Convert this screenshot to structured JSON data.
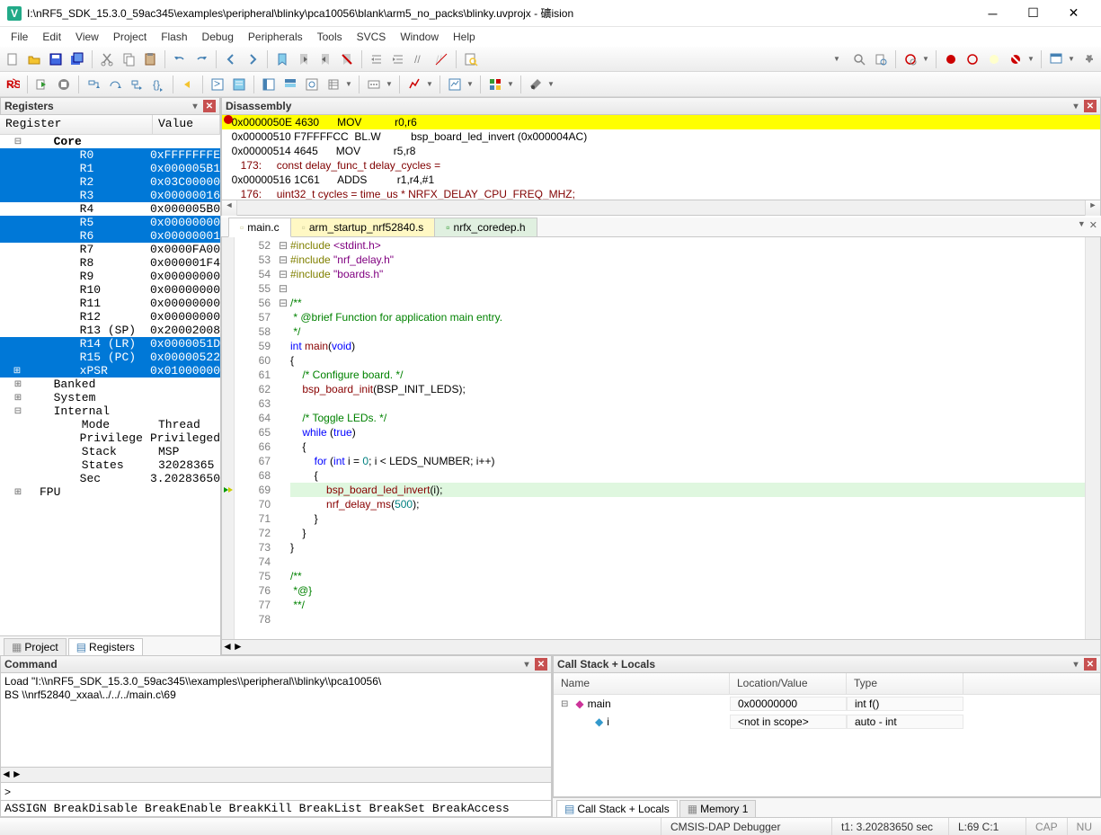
{
  "title": "I:\\nRF5_SDK_15.3.0_59ac345\\examples\\peripheral\\blinky\\pca10056\\blank\\arm5_no_packs\\blinky.uvprojx - 礦ision",
  "menus": [
    "File",
    "Edit",
    "View",
    "Project",
    "Flash",
    "Debug",
    "Peripherals",
    "Tools",
    "SVCS",
    "Window",
    "Help"
  ],
  "panels": {
    "registers_title": "Registers",
    "disassembly_title": "Disassembly",
    "command_title": "Command",
    "callstack_title": "Call Stack + Locals"
  },
  "reg_headers": [
    "Register",
    "Value"
  ],
  "registers": [
    {
      "n": "Core",
      "v": "",
      "tree": "⊟",
      "i": 0,
      "sel": false,
      "bold": true
    },
    {
      "n": "R0",
      "v": "0xFFFFFFFE",
      "i": 2,
      "sel": true
    },
    {
      "n": "R1",
      "v": "0x000005B1",
      "i": 2,
      "sel": true
    },
    {
      "n": "R2",
      "v": "0x03C00000",
      "i": 2,
      "sel": true
    },
    {
      "n": "R3",
      "v": "0x00000016",
      "i": 2,
      "sel": true
    },
    {
      "n": "R4",
      "v": "0x000005B0",
      "i": 2,
      "sel": false
    },
    {
      "n": "R5",
      "v": "0x00000000",
      "i": 2,
      "sel": true
    },
    {
      "n": "R6",
      "v": "0x00000001",
      "i": 2,
      "sel": true
    },
    {
      "n": "R7",
      "v": "0x0000FA00",
      "i": 2,
      "sel": false
    },
    {
      "n": "R8",
      "v": "0x000001F4",
      "i": 2,
      "sel": false
    },
    {
      "n": "R9",
      "v": "0x00000000",
      "i": 2,
      "sel": false
    },
    {
      "n": "R10",
      "v": "0x00000000",
      "i": 2,
      "sel": false
    },
    {
      "n": "R11",
      "v": "0x00000000",
      "i": 2,
      "sel": false
    },
    {
      "n": "R12",
      "v": "0x00000000",
      "i": 2,
      "sel": false
    },
    {
      "n": "R13 (SP)",
      "v": "0x20002008",
      "i": 2,
      "sel": false
    },
    {
      "n": "R14 (LR)",
      "v": "0x0000051D",
      "i": 2,
      "sel": true
    },
    {
      "n": "R15 (PC)",
      "v": "0x00000522",
      "i": 2,
      "sel": true
    },
    {
      "n": "xPSR",
      "v": "0x01000000",
      "tree": "⊞",
      "i": 2,
      "sel": true
    },
    {
      "n": "Banked",
      "v": "",
      "tree": "⊞",
      "i": 0,
      "sel": false
    },
    {
      "n": "System",
      "v": "",
      "tree": "⊞",
      "i": 0,
      "sel": false
    },
    {
      "n": "Internal",
      "v": "",
      "tree": "⊟",
      "i": 0,
      "sel": false
    },
    {
      "n": "Mode",
      "v": "Thread",
      "i": 2,
      "sel": false
    },
    {
      "n": "Privilege",
      "v": "Privileged",
      "i": 2,
      "sel": false
    },
    {
      "n": "Stack",
      "v": "MSP",
      "i": 2,
      "sel": false
    },
    {
      "n": "States",
      "v": "32028365",
      "i": 2,
      "sel": false
    },
    {
      "n": "Sec",
      "v": "3.20283650",
      "i": 2,
      "sel": false
    },
    {
      "n": "FPU",
      "v": "",
      "tree": "⊞",
      "i": -1,
      "sel": false
    }
  ],
  "reg_bottom_tabs": [
    "Project",
    "Registers"
  ],
  "disasm": [
    {
      "t": "0x0000050E 4630      MOV           r0,r6",
      "cur": true,
      "bp": true
    },
    {
      "t": "0x00000510 F7FFFFCC  BL.W          bsp_board_led_invert (0x000004AC)"
    },
    {
      "t": "0x00000514 4645      MOV           r5,r8"
    },
    {
      "t": "   173:     const delay_func_t delay_cycles =",
      "src": true
    },
    {
      "t": "0x00000516 1C61      ADDS          r1,r4,#1"
    },
    {
      "t": "   176:     uint32_t cycles = time_us * NRFX_DELAY_CPU_FREQ_MHZ;",
      "src": true
    }
  ],
  "editor_tabs": [
    {
      "label": "main.c",
      "kind": "active"
    },
    {
      "label": "arm_startup_nrf52840.s",
      "kind": "yellow"
    },
    {
      "label": "nrfx_coredep.h",
      "kind": "green"
    }
  ],
  "first_line": 52,
  "code": [
    {
      "seg": [
        [
          "pp",
          "#include "
        ],
        [
          "inc",
          "<stdint.h>"
        ]
      ]
    },
    {
      "seg": [
        [
          "pp",
          "#include "
        ],
        [
          "inc",
          "\"nrf_delay.h\""
        ]
      ]
    },
    {
      "seg": [
        [
          "pp",
          "#include "
        ],
        [
          "inc",
          "\"boards.h\""
        ]
      ]
    },
    {
      "seg": []
    },
    {
      "fold": "⊟",
      "seg": [
        [
          "cm",
          "/**"
        ]
      ]
    },
    {
      "seg": [
        [
          "cm",
          " * @brief Function for application main entry."
        ]
      ]
    },
    {
      "seg": [
        [
          "cm",
          " */"
        ]
      ]
    },
    {
      "seg": [
        [
          "kw",
          "int"
        ],
        [
          "",
          " "
        ],
        [
          "fn",
          "main"
        ],
        [
          "",
          "("
        ],
        [
          "kw",
          "void"
        ],
        [
          "",
          ")"
        ]
      ]
    },
    {
      "fold": "⊟",
      "seg": [
        [
          "",
          "{"
        ]
      ]
    },
    {
      "seg": [
        [
          "",
          "    "
        ],
        [
          "cm",
          "/* Configure board. */"
        ]
      ]
    },
    {
      "seg": [
        [
          "",
          "    "
        ],
        [
          "fn",
          "bsp_board_init"
        ],
        [
          "",
          "(BSP_INIT_LEDS);"
        ]
      ]
    },
    {
      "seg": []
    },
    {
      "seg": [
        [
          "",
          "    "
        ],
        [
          "cm",
          "/* Toggle LEDs. */"
        ]
      ]
    },
    {
      "seg": [
        [
          "",
          "    "
        ],
        [
          "kw",
          "while"
        ],
        [
          "",
          " ("
        ],
        [
          "kw",
          "true"
        ],
        [
          "",
          ")"
        ]
      ]
    },
    {
      "fold": "⊟",
      "seg": [
        [
          "",
          "    {"
        ]
      ]
    },
    {
      "seg": [
        [
          "",
          "        "
        ],
        [
          "kw",
          "for"
        ],
        [
          "",
          " ("
        ],
        [
          "kw",
          "int"
        ],
        [
          "",
          " i = "
        ],
        [
          "num",
          "0"
        ],
        [
          "",
          "; i < LEDS_NUMBER; i++)"
        ]
      ]
    },
    {
      "fold": "⊟",
      "seg": [
        [
          "",
          "        {"
        ]
      ]
    },
    {
      "hl": true,
      "mark": "cur",
      "seg": [
        [
          "",
          "            "
        ],
        [
          "fn",
          "bsp_board_led_invert"
        ],
        [
          "",
          "(i);"
        ]
      ]
    },
    {
      "seg": [
        [
          "",
          "            "
        ],
        [
          "fn",
          "nrf_delay_ms"
        ],
        [
          "",
          "("
        ],
        [
          "num",
          "500"
        ],
        [
          "",
          ");"
        ]
      ]
    },
    {
      "seg": [
        [
          "",
          "        }"
        ]
      ]
    },
    {
      "seg": [
        [
          "",
          "    }"
        ]
      ]
    },
    {
      "seg": [
        [
          "",
          "}"
        ]
      ]
    },
    {
      "seg": []
    },
    {
      "fold": "⊟",
      "seg": [
        [
          "cm",
          "/**"
        ]
      ]
    },
    {
      "seg": [
        [
          "cm",
          " *@}"
        ]
      ]
    },
    {
      "seg": [
        [
          "cm",
          " **/"
        ]
      ]
    },
    {
      "seg": []
    }
  ],
  "command_lines": [
    "Load \"I:\\\\nRF5_SDK_15.3.0_59ac345\\\\examples\\\\peripheral\\\\blinky\\\\pca10056\\",
    "BS \\\\nrf52840_xxaa\\../../../main.c\\69"
  ],
  "command_prompt": ">",
  "command_hints": "ASSIGN BreakDisable BreakEnable BreakKill BreakList BreakSet BreakAccess",
  "callstack": {
    "headers": [
      "Name",
      "Location/Value",
      "Type"
    ],
    "rows": [
      {
        "tree": "⊟",
        "icon": "f",
        "name": "main",
        "loc": "0x00000000",
        "type": "int f()"
      },
      {
        "tree": "",
        "icon": "v",
        "name": "i",
        "loc": "<not in scope>",
        "type": "auto - int",
        "indent": 1
      }
    ],
    "tabs": [
      "Call Stack + Locals",
      "Memory 1"
    ]
  },
  "status": {
    "debugger": "CMSIS-DAP Debugger",
    "time": "t1: 3.20283650 sec",
    "pos": "L:69 C:1",
    "cap": "CAP",
    "num": "NU"
  }
}
